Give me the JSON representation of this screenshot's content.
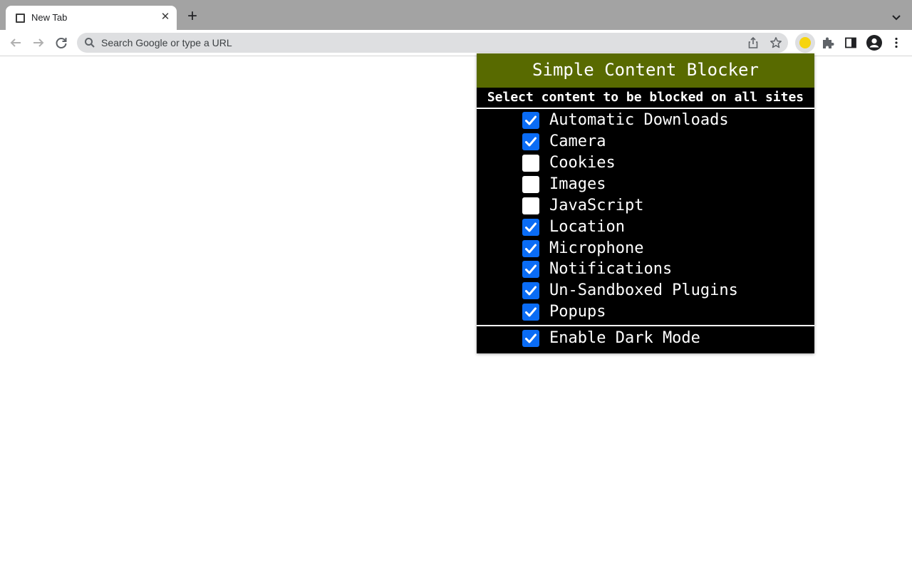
{
  "browser": {
    "tab_title": "New Tab",
    "new_tab_label": "+",
    "omnibox_placeholder": "Search Google or type a URL"
  },
  "popup": {
    "title": "Simple Content Blocker",
    "subtitle": "Select content to be blocked on all sites",
    "options": [
      {
        "label": "Automatic Downloads",
        "checked": true
      },
      {
        "label": "Camera",
        "checked": true
      },
      {
        "label": "Cookies",
        "checked": false
      },
      {
        "label": "Images",
        "checked": false
      },
      {
        "label": "JavaScript",
        "checked": false
      },
      {
        "label": "Location",
        "checked": true
      },
      {
        "label": "Microphone",
        "checked": true
      },
      {
        "label": "Notifications",
        "checked": true
      },
      {
        "label": "Un-Sandboxed Plugins",
        "checked": true
      },
      {
        "label": "Popups",
        "checked": true
      }
    ],
    "dark_mode": {
      "label": "Enable Dark Mode",
      "checked": true
    }
  },
  "colors": {
    "header_bg": "#586a00",
    "checkbox_checked": "#0a6cf5",
    "popup_bg": "#000000"
  }
}
